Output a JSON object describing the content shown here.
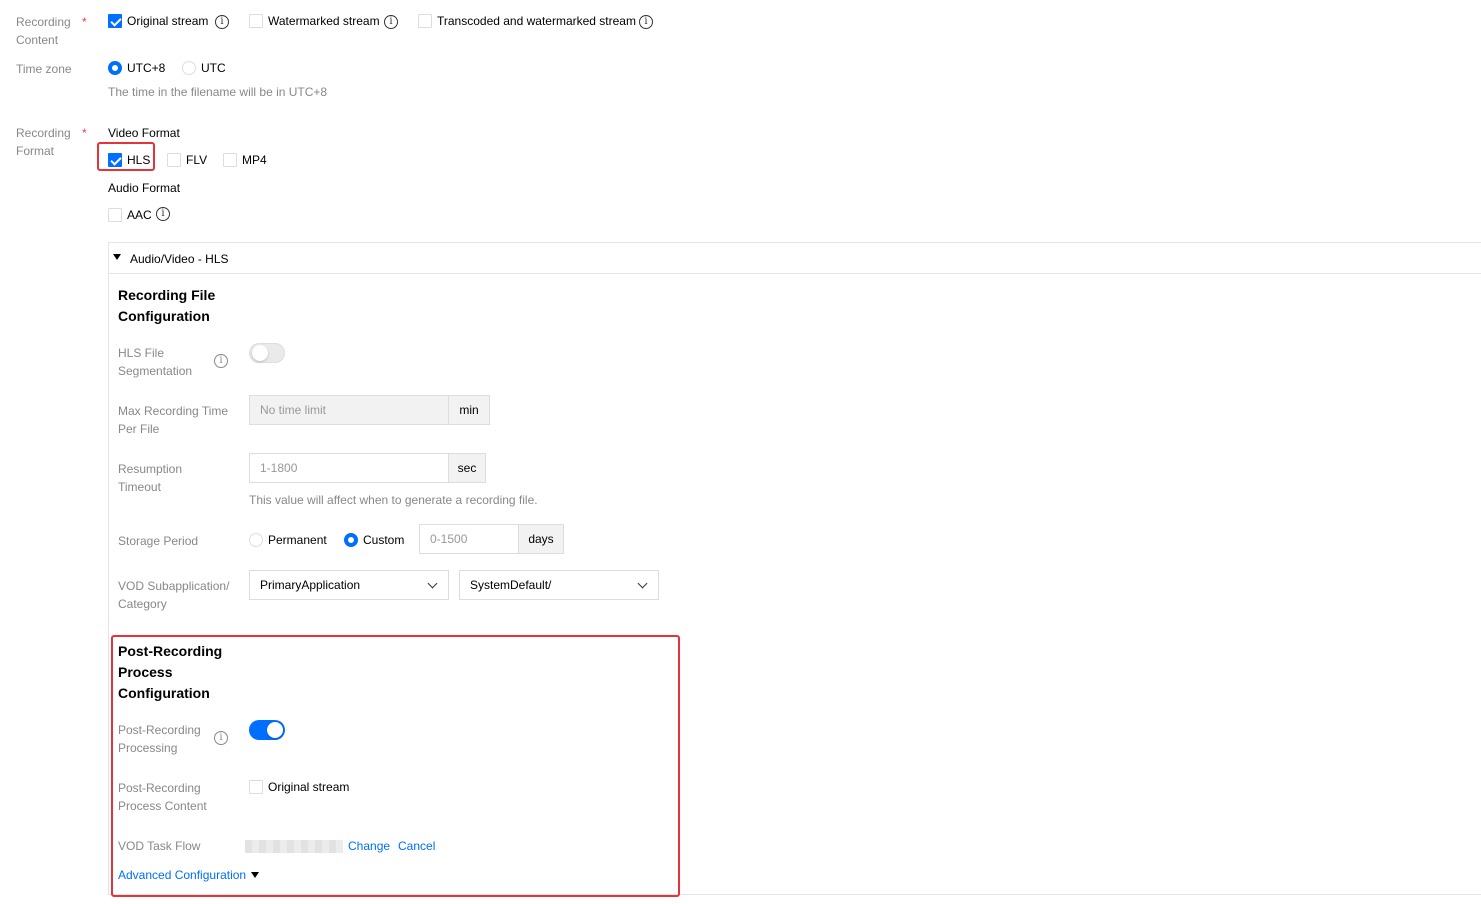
{
  "recording_content": {
    "label": "Recording Content",
    "options": [
      {
        "label": "Original stream",
        "checked": true
      },
      {
        "label": "Watermarked stream",
        "checked": false
      },
      {
        "label": "Transcoded and watermarked stream",
        "checked": false
      }
    ]
  },
  "time_zone": {
    "label": "Time zone",
    "options": [
      {
        "label": "UTC+8",
        "selected": true
      },
      {
        "label": "UTC",
        "selected": false
      }
    ],
    "hint": "The time in the filename will be in UTC+8"
  },
  "recording_format": {
    "label": "Recording Format",
    "video_format_label": "Video Format",
    "video_options": [
      {
        "label": "HLS",
        "checked": true
      },
      {
        "label": "FLV",
        "checked": false
      },
      {
        "label": "MP4",
        "checked": false
      }
    ],
    "audio_format_label": "Audio Format",
    "audio_options": [
      {
        "label": "AAC",
        "checked": false
      }
    ]
  },
  "panel": {
    "header": "Audio/Video - HLS",
    "file_config_title": "Recording File Configuration",
    "hls_segmentation": {
      "label": "HLS File Segmentation",
      "enabled": false
    },
    "max_recording_time": {
      "label": "Max Recording Time Per File",
      "placeholder": "No time limit",
      "unit": "min"
    },
    "resumption_timeout": {
      "label": "Resumption Timeout",
      "placeholder": "1-1800",
      "unit": "sec",
      "hint": "This value will affect when to generate a recording file."
    },
    "storage_period": {
      "label": "Storage Period",
      "options": [
        {
          "label": "Permanent",
          "selected": false
        },
        {
          "label": "Custom",
          "selected": true
        }
      ],
      "placeholder": "0-1500",
      "unit": "days"
    },
    "vod_subapplication": {
      "label": "VOD Subapplication/Category",
      "app_value": "PrimaryApplication",
      "category_value": "SystemDefault/"
    },
    "post_recording_title": "Post-Recording Process Configuration",
    "post_recording_processing": {
      "label": "Post-Recording Processing",
      "enabled": true
    },
    "post_recording_content": {
      "label": "Post-Recording Process Content",
      "option": "Original stream",
      "checked": false
    },
    "vod_task_flow": {
      "label": "VOD Task Flow",
      "change": "Change",
      "cancel": "Cancel"
    },
    "advanced": "Advanced Configuration"
  },
  "colors": {
    "accent": "#006eff",
    "highlight": "#e5333a",
    "label": "#888888"
  }
}
